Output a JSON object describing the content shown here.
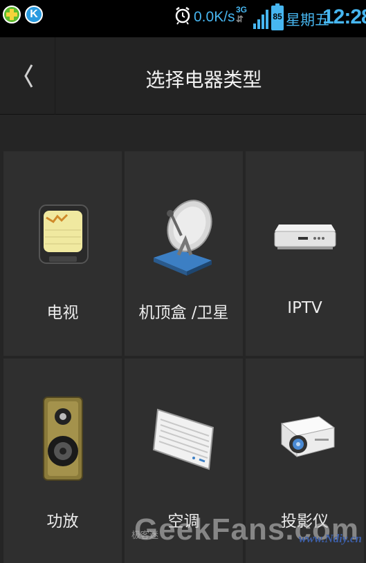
{
  "status_bar": {
    "app_icon_1": "qihoo-security-icon",
    "app_icon_2": {
      "icon": "k-app-icon",
      "letter": "K"
    },
    "alarm_icon": "alarm-clock-icon",
    "net_speed": "0.0K/s",
    "network_type": "3G",
    "network_arrows": "⇵",
    "signal_icon": "signal-bars-icon",
    "battery_level": "85",
    "weekday": "星期五",
    "time": "12:28",
    "accent_color": "#47b6f0"
  },
  "header": {
    "back_icon": "chevron-left-icon",
    "title": "选择电器类型"
  },
  "devices": [
    {
      "label": "电视",
      "icon": "tv-icon"
    },
    {
      "label": "机顶盒 /卫星",
      "icon": "satellite-dish-icon"
    },
    {
      "label": "IPTV",
      "icon": "iptv-box-icon"
    },
    {
      "label": "功放",
      "icon": "speaker-icon"
    },
    {
      "label": "空调",
      "icon": "air-conditioner-icon"
    },
    {
      "label": "投影仪",
      "icon": "projector-icon"
    }
  ],
  "watermark": {
    "brand": "GeekFans.com",
    "small_text": "极客迷",
    "url": "www.Ndiy.cn"
  }
}
